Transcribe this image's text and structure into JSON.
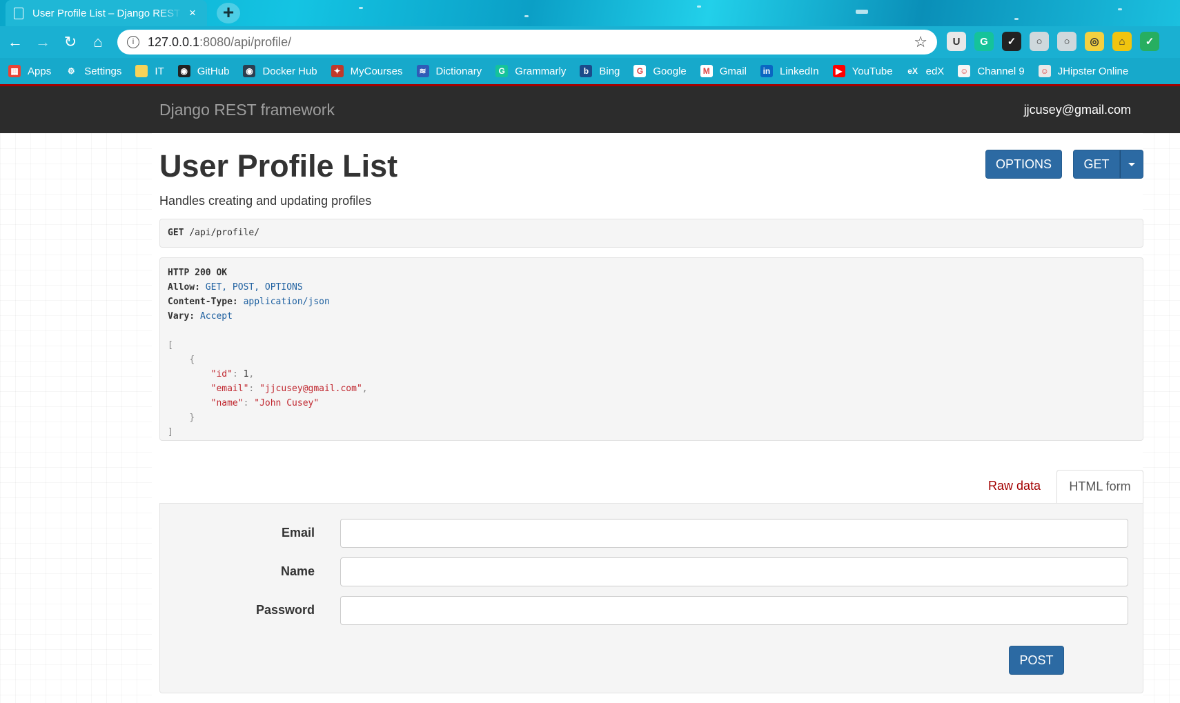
{
  "browser": {
    "tab_title": "User Profile List – Django REST framework",
    "tab_close": "×",
    "new_tab": "+",
    "url_host": "127.0.0.1",
    "url_path": ":8080/api/profile/",
    "nav": {
      "back": "←",
      "forward": "→",
      "reload": "↻",
      "home": "⌂"
    },
    "star": "☆",
    "extensions": [
      {
        "icon": "ublock-icon",
        "glyph": "U",
        "color": "#e8e8e8"
      },
      {
        "icon": "grammarly-ext-icon",
        "glyph": "G",
        "color": "#15c39a"
      },
      {
        "icon": "todo-check-icon",
        "glyph": "✓",
        "color": "#222"
      },
      {
        "icon": "circle-ext-icon",
        "glyph": "○",
        "color": "#cfd8dc"
      },
      {
        "icon": "circle-ext-2-icon",
        "glyph": "○",
        "color": "#cfd8dc"
      },
      {
        "icon": "magnifier-ext-icon",
        "glyph": "◎",
        "color": "#f4d03f"
      },
      {
        "icon": "home-ext-icon",
        "glyph": "⌂",
        "color": "#f1c40f"
      },
      {
        "icon": "green-check-icon",
        "glyph": "✓",
        "color": "#27ae60"
      }
    ],
    "bookmarks": [
      {
        "label": "Apps",
        "icon": "apps-grid-icon",
        "glyph": "▦",
        "color": "#ea4335"
      },
      {
        "label": "Settings",
        "icon": "gear-icon",
        "glyph": "⚙",
        "color": "transparent"
      },
      {
        "label": "IT",
        "icon": "folder-icon",
        "glyph": "",
        "color": "#f7d358"
      },
      {
        "label": "GitHub",
        "icon": "github-icon",
        "glyph": "◉",
        "color": "#222"
      },
      {
        "label": "Docker Hub",
        "icon": "docker-icon",
        "glyph": "◉",
        "color": "#2c3e50"
      },
      {
        "label": "MyCourses",
        "icon": "mycourses-icon",
        "glyph": "✦",
        "color": "#c0392b"
      },
      {
        "label": "Dictionary",
        "icon": "dictionary-icon",
        "glyph": "≋",
        "color": "#2f5bb7"
      },
      {
        "label": "Grammarly",
        "icon": "grammarly-icon",
        "glyph": "G",
        "color": "#15c39a"
      },
      {
        "label": "Bing",
        "icon": "bing-icon",
        "glyph": "b",
        "color": "#1b4b8a"
      },
      {
        "label": "Google",
        "icon": "google-icon",
        "glyph": "G",
        "color": "#fff"
      },
      {
        "label": "Gmail",
        "icon": "gmail-icon",
        "glyph": "M",
        "color": "#fff"
      },
      {
        "label": "LinkedIn",
        "icon": "linkedin-icon",
        "glyph": "in",
        "color": "#0a66c2"
      },
      {
        "label": "YouTube",
        "icon": "youtube-icon",
        "glyph": "▶",
        "color": "#ff0000"
      },
      {
        "label": "edX",
        "icon": "edx-icon",
        "glyph": "eX",
        "color": "transparent"
      },
      {
        "label": "Channel 9",
        "icon": "channel9-icon",
        "glyph": "☺",
        "color": "#f5f5f5"
      },
      {
        "label": "JHipster Online",
        "icon": "jhipster-icon",
        "glyph": "☺",
        "color": "#e8e8e8"
      }
    ]
  },
  "navbar": {
    "brand": "Django REST framework",
    "user": "jjcusey@gmail.com"
  },
  "page": {
    "title": "User Profile List",
    "description": "Handles creating and updating profiles",
    "options_label": "OPTIONS",
    "get_label": "GET"
  },
  "request": {
    "method": "GET",
    "path": "/api/profile/"
  },
  "response": {
    "status": "HTTP 200 OK",
    "headers": [
      {
        "key": "Allow:",
        "value": "GET, POST, OPTIONS"
      },
      {
        "key": "Content-Type:",
        "value": "application/json"
      },
      {
        "key": "Vary:",
        "value": "Accept"
      }
    ],
    "body": {
      "id_key": "\"id\"",
      "id_value": "1",
      "email_key": "\"email\"",
      "email_value": "\"jjcusey@gmail.com\"",
      "name_key": "\"name\"",
      "name_value": "\"John Cusey\""
    }
  },
  "form": {
    "tab_raw": "Raw data",
    "tab_html": "HTML form",
    "fields": [
      {
        "label": "Email",
        "value": ""
      },
      {
        "label": "Name",
        "value": ""
      },
      {
        "label": "Password",
        "value": ""
      }
    ],
    "submit_label": "POST"
  }
}
